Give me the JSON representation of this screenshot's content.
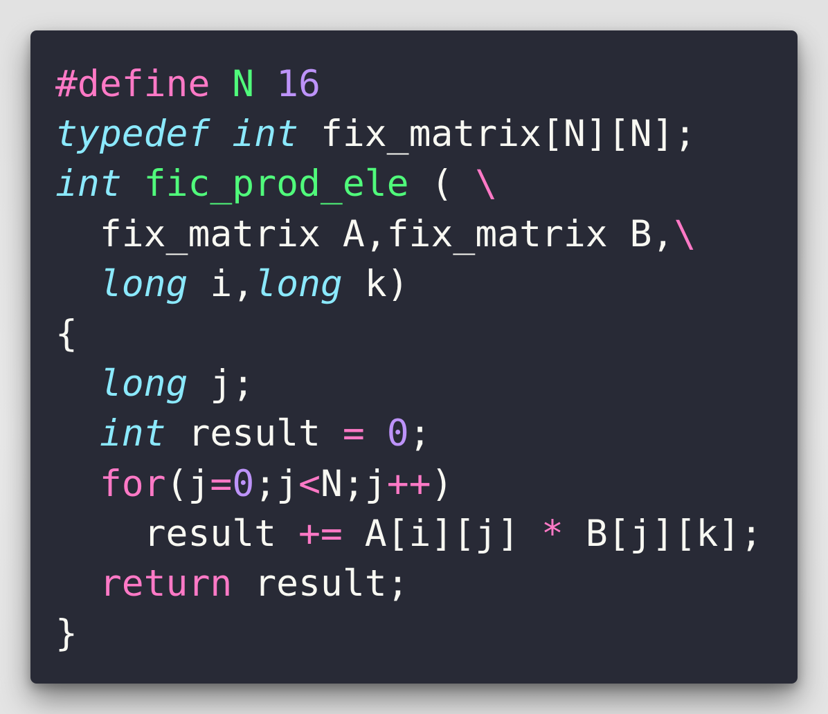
{
  "code_block": {
    "lines": [
      [
        {
          "text": "#define",
          "kind": "pink"
        },
        {
          "text": " ",
          "kind": "plain"
        },
        {
          "text": "N",
          "kind": "green"
        },
        {
          "text": " ",
          "kind": "plain"
        },
        {
          "text": "16",
          "kind": "purple"
        }
      ],
      [
        {
          "text": "typedef",
          "kind": "cyan"
        },
        {
          "text": " ",
          "kind": "plain"
        },
        {
          "text": "int",
          "kind": "cyan"
        },
        {
          "text": " fix_matrix[N][N];",
          "kind": "plain"
        }
      ],
      [
        {
          "text": "int",
          "kind": "cyan"
        },
        {
          "text": " ",
          "kind": "plain"
        },
        {
          "text": "fic_prod_ele",
          "kind": "green"
        },
        {
          "text": " ( ",
          "kind": "plain"
        },
        {
          "text": "\\",
          "kind": "pink"
        }
      ],
      [
        {
          "text": "  fix_matrix A,fix_matrix B,",
          "kind": "plain"
        },
        {
          "text": "\\",
          "kind": "pink"
        }
      ],
      [
        {
          "text": "  ",
          "kind": "plain"
        },
        {
          "text": "long",
          "kind": "cyan"
        },
        {
          "text": " i,",
          "kind": "plain"
        },
        {
          "text": "long",
          "kind": "cyan"
        },
        {
          "text": " k)",
          "kind": "plain"
        }
      ],
      [
        {
          "text": "{",
          "kind": "plain"
        }
      ],
      [
        {
          "text": "  ",
          "kind": "plain"
        },
        {
          "text": "long",
          "kind": "cyan"
        },
        {
          "text": " j;",
          "kind": "plain"
        }
      ],
      [
        {
          "text": "  ",
          "kind": "plain"
        },
        {
          "text": "int",
          "kind": "cyan"
        },
        {
          "text": " result ",
          "kind": "plain"
        },
        {
          "text": "=",
          "kind": "pink"
        },
        {
          "text": " ",
          "kind": "plain"
        },
        {
          "text": "0",
          "kind": "purple"
        },
        {
          "text": ";",
          "kind": "plain"
        }
      ],
      [
        {
          "text": "  ",
          "kind": "plain"
        },
        {
          "text": "for",
          "kind": "pink"
        },
        {
          "text": "(j",
          "kind": "plain"
        },
        {
          "text": "=",
          "kind": "pink"
        },
        {
          "text": "0",
          "kind": "purple"
        },
        {
          "text": ";j",
          "kind": "plain"
        },
        {
          "text": "<",
          "kind": "pink"
        },
        {
          "text": "N;j",
          "kind": "plain"
        },
        {
          "text": "++",
          "kind": "pink"
        },
        {
          "text": ")",
          "kind": "plain"
        }
      ],
      [
        {
          "text": "    result ",
          "kind": "plain"
        },
        {
          "text": "+=",
          "kind": "pink"
        },
        {
          "text": " A[i][j] ",
          "kind": "plain"
        },
        {
          "text": "*",
          "kind": "pink"
        },
        {
          "text": " B[j][k];",
          "kind": "plain"
        }
      ],
      [
        {
          "text": "  ",
          "kind": "plain"
        },
        {
          "text": "return",
          "kind": "pink"
        },
        {
          "text": " result;",
          "kind": "plain"
        }
      ],
      [
        {
          "text": "}",
          "kind": "plain"
        }
      ]
    ]
  }
}
